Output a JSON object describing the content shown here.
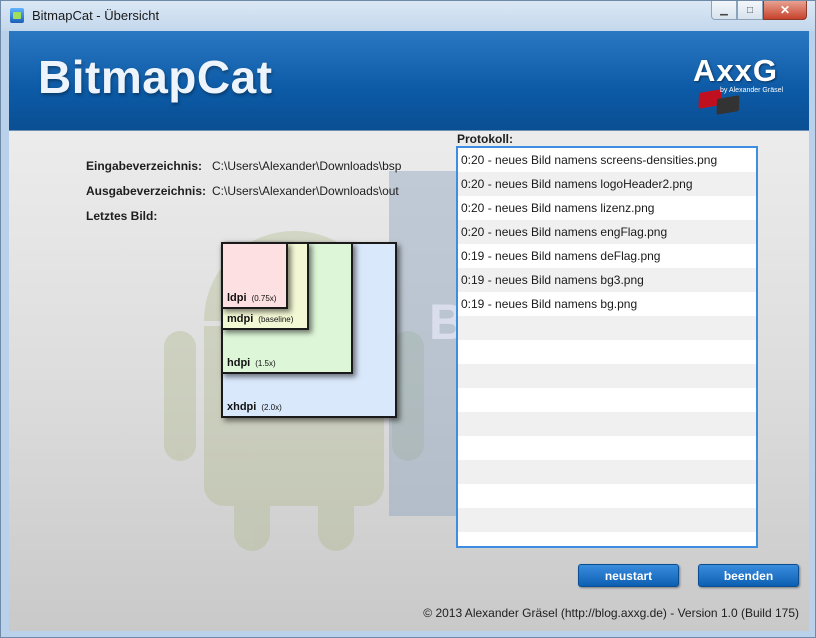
{
  "window": {
    "title": "BitmapCat - Übersicht",
    "minimize_glyph": "▁",
    "maximize_glyph": "□",
    "close_glyph": "✕"
  },
  "banner": {
    "title": "BitmapCat",
    "logo_text": "AxxG",
    "logo_subtext": "by Alexander Gräsel"
  },
  "info": {
    "input_label": "Eingabeverzeichnis:",
    "input_value": "C:\\Users\\Alexander\\Downloads\\bsp",
    "output_label": "Ausgabeverzeichnis:",
    "output_value": "C:\\Users\\Alexander\\Downloads\\out",
    "last_image_label": "Letztes Bild:"
  },
  "preview": {
    "densities": [
      {
        "name": "ldpi",
        "note": "(0.75x)",
        "color": "#fde0e2"
      },
      {
        "name": "mdpi",
        "note": "(baseline)",
        "color": "#f3f8d4"
      },
      {
        "name": "hdpi",
        "note": "(1.5x)",
        "color": "#def6d8"
      },
      {
        "name": "xhdpi",
        "note": "(2.0x)",
        "color": "#d9e8fb"
      }
    ]
  },
  "log": {
    "label": "Protokoll:",
    "entries": [
      "0:20 - neues Bild namens screens-densities.png",
      "0:20 - neues Bild namens logoHeader2.png",
      "0:20 - neues Bild namens lizenz.png",
      "0:20 - neues Bild namens engFlag.png",
      "0:19 - neues Bild namens deFlag.png",
      "0:19 - neues Bild namens bg3.png",
      "0:19 - neues Bild namens bg.png"
    ]
  },
  "buttons": {
    "restart": "neustart",
    "exit": "beenden"
  },
  "footer": "© 2013 Alexander Gräsel (http://blog.axxg.de) - Version 1.0 (Build 175)",
  "colors": {
    "banner": "#0c5aa6",
    "accent": "#3d8de0",
    "button": "#1f6fc4"
  }
}
